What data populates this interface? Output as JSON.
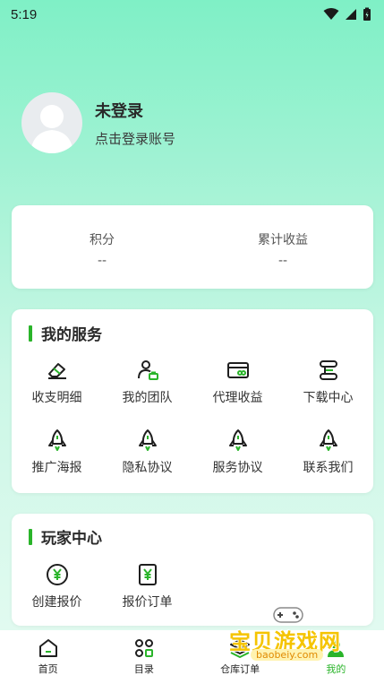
{
  "status_bar": {
    "time": "5:19"
  },
  "profile": {
    "name": "未登录",
    "subtitle": "点击登录账号"
  },
  "stats": [
    {
      "label": "积分",
      "value": "--"
    },
    {
      "label": "累计收益",
      "value": "--"
    }
  ],
  "services": {
    "title": "我的服务",
    "items": [
      {
        "label": "收支明细",
        "icon": "eraser-icon"
      },
      {
        "label": "我的团队",
        "icon": "team-icon"
      },
      {
        "label": "代理收益",
        "icon": "wallet-icon"
      },
      {
        "label": "下载中心",
        "icon": "download-icon"
      },
      {
        "label": "推广海报",
        "icon": "rocket-icon"
      },
      {
        "label": "隐私协议",
        "icon": "rocket-icon"
      },
      {
        "label": "服务协议",
        "icon": "rocket-icon"
      },
      {
        "label": "联系我们",
        "icon": "rocket-icon"
      }
    ]
  },
  "players": {
    "title": "玩家中心",
    "items": [
      {
        "label": "创建报价",
        "icon": "yen-circle-icon"
      },
      {
        "label": "报价订单",
        "icon": "yen-document-icon"
      }
    ]
  },
  "tabbar": {
    "items": [
      {
        "label": "首页",
        "icon": "home-icon",
        "active": false
      },
      {
        "label": "目录",
        "icon": "catalog-icon",
        "active": false
      },
      {
        "label": "仓库订单",
        "icon": "layers-icon",
        "active": false
      },
      {
        "label": "我的",
        "icon": "profile-icon",
        "active": true
      }
    ]
  },
  "watermark": {
    "text": "宝贝游戏网",
    "url": "baobeiy.com"
  },
  "colors": {
    "accent": "#2ab42a",
    "icon": "#1f1f1f"
  }
}
